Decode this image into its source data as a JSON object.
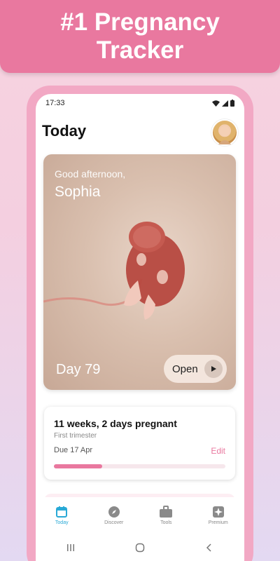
{
  "banner": {
    "line1": "#1 Pregnancy",
    "line2": "Tracker"
  },
  "status": {
    "time": "17:33"
  },
  "header": {
    "title": "Today"
  },
  "hero": {
    "greeting": "Good afternoon,",
    "name": "Sophia",
    "day_label": "Day 79",
    "open_label": "Open"
  },
  "pregnancy_card": {
    "weeks_text": "11 weeks, 2 days pregnant",
    "trimester": "First trimester",
    "due": "Due 17 Apr",
    "edit_label": "Edit",
    "progress_fraction": 0.28
  },
  "tabs": [
    {
      "label": "Today",
      "icon": "calendar-icon",
      "active": true
    },
    {
      "label": "Discover",
      "icon": "compass-icon",
      "active": false
    },
    {
      "label": "Tools",
      "icon": "briefcase-icon",
      "active": false
    },
    {
      "label": "Premium",
      "icon": "sparkle-icon",
      "active": false
    }
  ],
  "colors": {
    "banner": "#e9789f",
    "accent_pink": "#e9789f",
    "tab_active": "#29a9d6",
    "phone_frame": "#f2a8c4"
  }
}
